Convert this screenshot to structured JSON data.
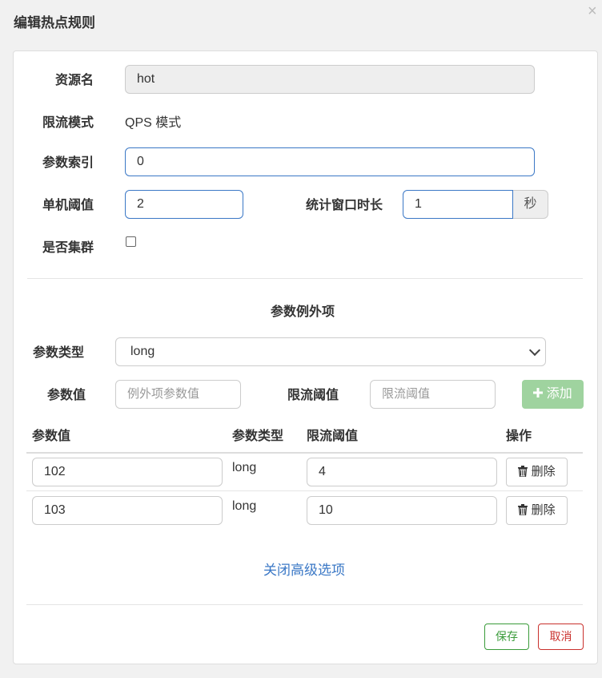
{
  "dialog": {
    "title": "编辑热点规则",
    "close_glyph": "×"
  },
  "form": {
    "resource_label": "资源名",
    "resource_value": "hot",
    "mode_label": "限流模式",
    "mode_value": "QPS 模式",
    "param_index_label": "参数索引",
    "param_index_value": "0",
    "threshold_label": "单机阈值",
    "threshold_value": "2",
    "window_label": "统计窗口时长",
    "window_value": "1",
    "window_unit": "秒",
    "cluster_label": "是否集群"
  },
  "exceptions": {
    "section_title": "参数例外项",
    "type_label": "参数类型",
    "type_selected": "long",
    "value_label": "参数值",
    "value_placeholder": "例外项参数值",
    "limit_label": "限流阈值",
    "limit_placeholder": "限流阈值",
    "add_button": "添加",
    "table": {
      "headers": [
        "参数值",
        "参数类型",
        "限流阈值",
        "操作"
      ],
      "rows": [
        {
          "value": "102",
          "type": "long",
          "limit": "4",
          "action": "删除"
        },
        {
          "value": "103",
          "type": "long",
          "limit": "10",
          "action": "删除"
        }
      ]
    },
    "toggle_link": "关闭高级选项"
  },
  "footer": {
    "save_button": "保存",
    "cancel_button": "取消"
  },
  "colors": {
    "primary": "#3b78c6",
    "success": "#3a9b3a",
    "success_light": "#9fd39f",
    "danger": "#c9302c"
  }
}
